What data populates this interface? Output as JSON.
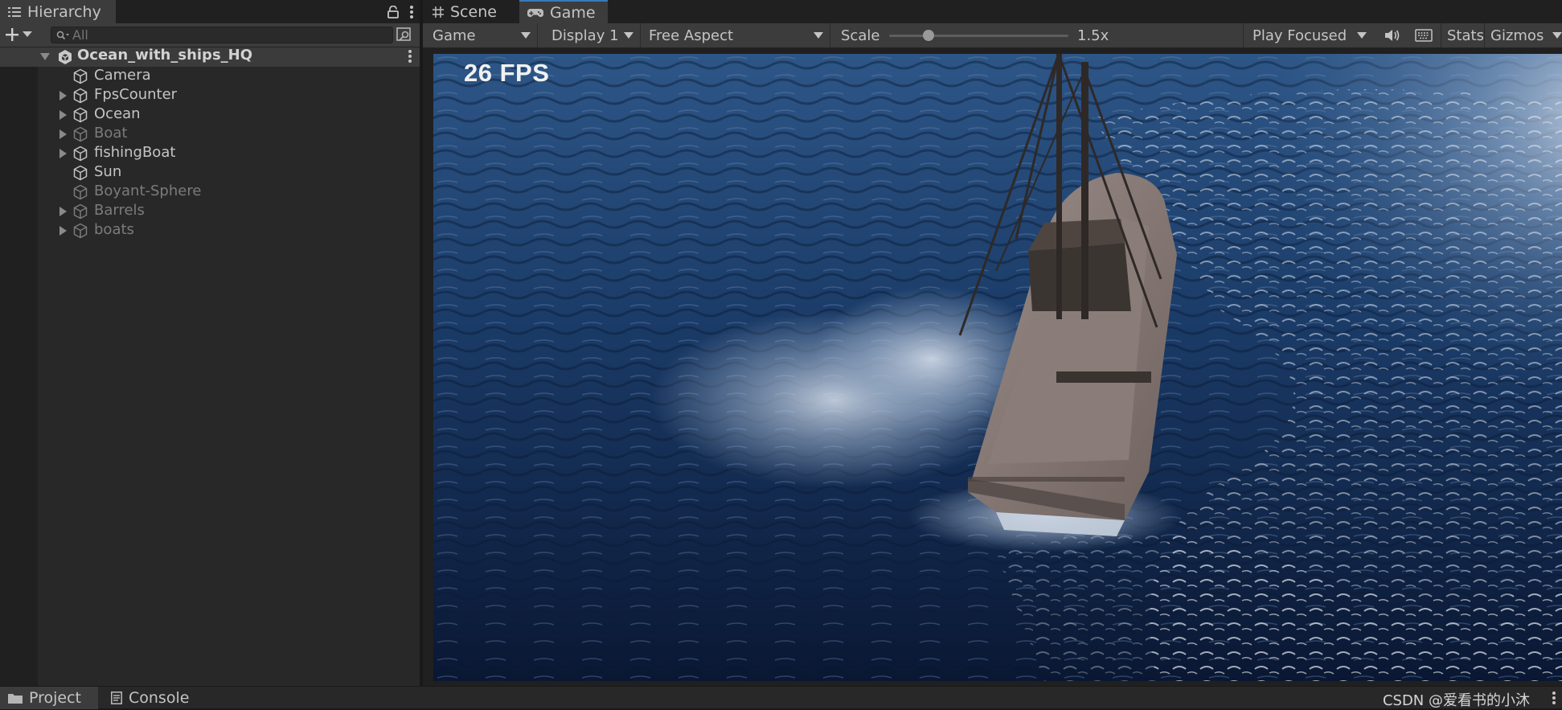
{
  "hierarchy": {
    "tab_label": "Hierarchy",
    "search_placeholder": "All",
    "scene_name": "Ocean_with_ships_HQ",
    "items": [
      {
        "label": "Camera",
        "expandable": false,
        "active": true
      },
      {
        "label": "FpsCounter",
        "expandable": true,
        "active": true
      },
      {
        "label": "Ocean",
        "expandable": true,
        "active": true
      },
      {
        "label": "Boat",
        "expandable": true,
        "active": false
      },
      {
        "label": "fishingBoat",
        "expandable": true,
        "active": true
      },
      {
        "label": "Sun",
        "expandable": false,
        "active": true
      },
      {
        "label": "Boyant-Sphere",
        "expandable": false,
        "active": false
      },
      {
        "label": "Barrels",
        "expandable": true,
        "active": false
      },
      {
        "label": "boats",
        "expandable": true,
        "active": false
      }
    ]
  },
  "game_tabs": {
    "scene_label": "Scene",
    "game_label": "Game"
  },
  "game_toolbar": {
    "view_mode": "Game",
    "display": "Display 1",
    "aspect": "Free Aspect",
    "scale_label": "Scale",
    "scale_value": "1.5x",
    "scale_fraction": 0.22,
    "play_mode": "Play Focused",
    "stats_label": "Stats",
    "gizmos_label": "Gizmos"
  },
  "viewport": {
    "fps_text": "26 FPS"
  },
  "bottom_tabs": {
    "project_label": "Project",
    "console_label": "Console"
  },
  "watermark": "CSDN @爱看书的小沐",
  "colors": {
    "accent": "#3a79bb",
    "panel": "#282828",
    "toolbar": "#3c3c3c",
    "text": "#c4c4c4",
    "inactive_text": "#7b7b7b"
  }
}
